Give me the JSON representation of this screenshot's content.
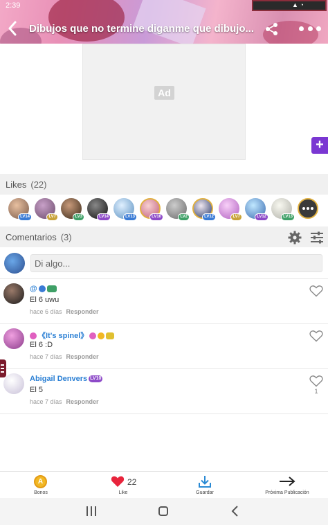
{
  "status_bar": {
    "time": "2:39"
  },
  "header": {
    "title": "Dibujos que no termine diganme que dibujo..."
  },
  "ad": {
    "label": "Ad"
  },
  "likes": {
    "title": "Likes",
    "count": "(22)",
    "users": [
      {
        "level": "LV14",
        "color": "#7a5a4a"
      },
      {
        "level": "LV7",
        "color": "#8a6a8a"
      },
      {
        "level": "LV3",
        "color": "#5a3a2a"
      },
      {
        "level": "LV14",
        "color": "#2a2a2a"
      },
      {
        "level": "LV13",
        "color": "#9ac0e0"
      },
      {
        "level": "LV10",
        "color": "#e0a0a0"
      },
      {
        "level": "LV2",
        "color": "#9a9a9a"
      },
      {
        "level": "LV12",
        "color": "#4a5a8a"
      },
      {
        "level": "LV7",
        "color": "#d89ad8"
      },
      {
        "level": "LV12",
        "color": "#6a9ad0"
      },
      {
        "level": "LV13",
        "color": "#d8d8d0"
      },
      {
        "level": "",
        "color": "#3a3a3a"
      }
    ]
  },
  "comments": {
    "title": "Comentarios",
    "count": "(3)",
    "input_placeholder": "Di algo...",
    "items": [
      {
        "author": "@",
        "text": "El 6 uwu",
        "time": "hace 6 días",
        "reply": "Responder",
        "likes": ""
      },
      {
        "author": "《It's spinel》",
        "text": "El 6 :D",
        "time": "hace 7 días",
        "reply": "Responder",
        "likes": ""
      },
      {
        "author": "Abigail Denvers",
        "author_level": "LV10",
        "text": "El 5",
        "time": "hace 7 días",
        "reply": "Responder",
        "likes": "1"
      }
    ]
  },
  "bottom_bar": {
    "bonos": "Bonos",
    "like": "Like",
    "like_count": "22",
    "save": "Guardar",
    "next": "Próxima Publicación"
  },
  "colors": {
    "accent": "#2a7fd4",
    "like_red": "#e8243c",
    "fab": "#7a37d2"
  }
}
